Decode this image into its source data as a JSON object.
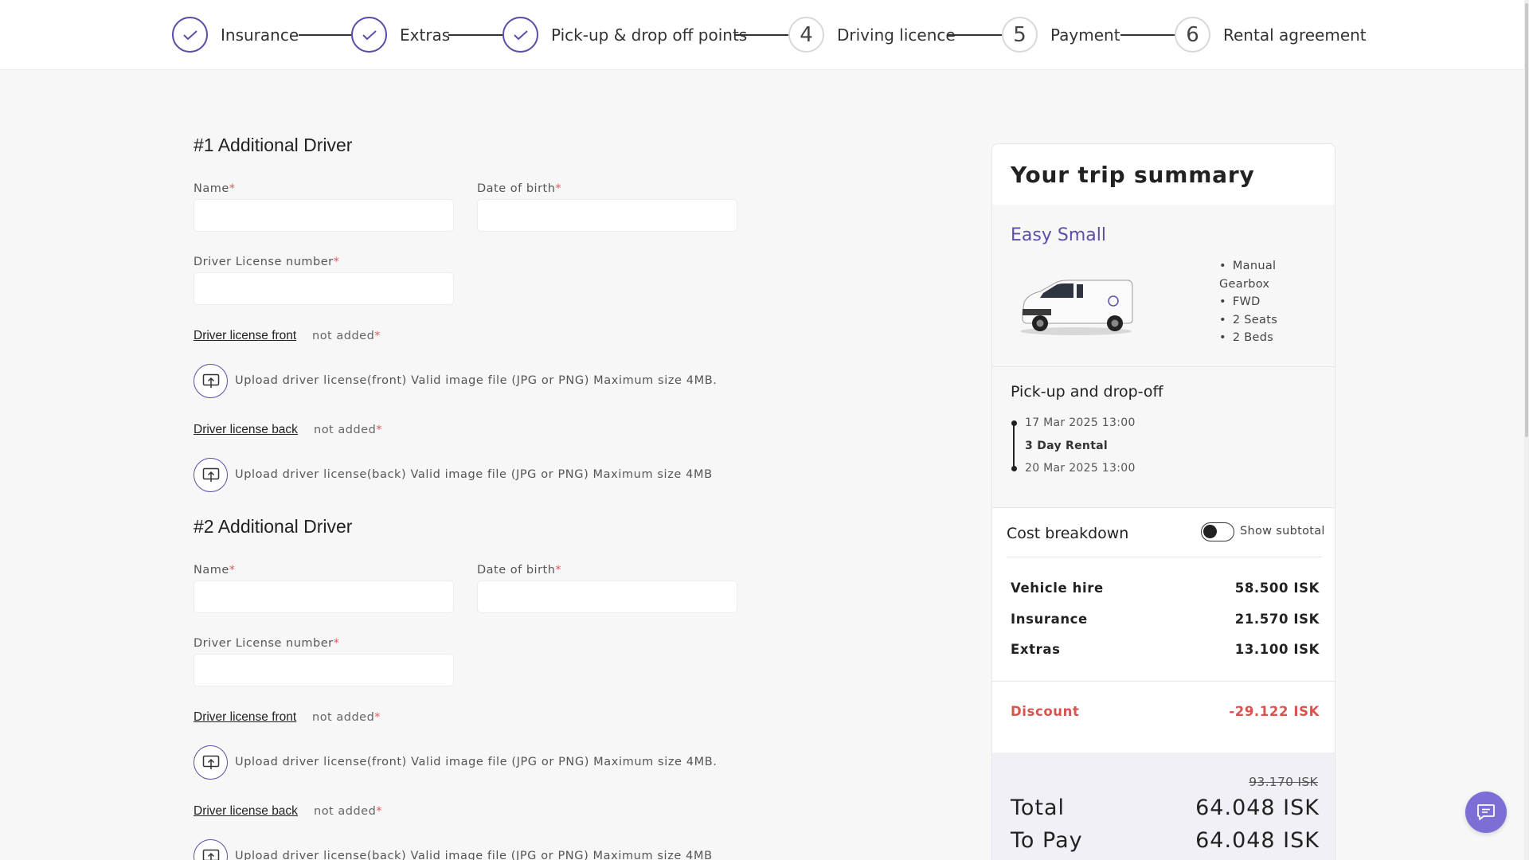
{
  "stepper": {
    "steps": [
      {
        "label": "Insurance",
        "state": "done"
      },
      {
        "label": "Extras",
        "state": "done"
      },
      {
        "label": "Pick-up & drop off points",
        "state": "done"
      },
      {
        "label": "Driving licence",
        "number": "4",
        "state": "todo"
      },
      {
        "label": "Payment",
        "number": "5",
        "state": "todo"
      },
      {
        "label": "Rental agreement",
        "number": "6",
        "state": "todo"
      }
    ]
  },
  "required_mark": "*",
  "drivers": [
    {
      "title": "#1 Additional Driver",
      "name_label": "Name",
      "dob_label": "Date of birth",
      "license_label": "Driver License number",
      "front_link": "Driver license front",
      "front_status": "not added",
      "front_upload_text": "Upload driver license(front) Valid image file (JPG or PNG) Maximum size 4MB.",
      "back_link": "Driver license back",
      "back_status": "not added",
      "back_upload_text": "Upload driver license(back) Valid image file (JPG or PNG) Maximum size 4MB"
    },
    {
      "title": "#2 Additional Driver",
      "name_label": "Name",
      "dob_label": "Date of birth",
      "license_label": "Driver License number",
      "front_link": "Driver license front",
      "front_status": "not added",
      "front_upload_text": "Upload driver license(front) Valid image file (JPG or PNG) Maximum size 4MB.",
      "back_link": "Driver license back",
      "back_status": "not added",
      "back_upload_text": "Upload driver license(back) Valid image file (JPG or PNG) Maximum size 4MB"
    }
  ],
  "summary": {
    "title": "Your trip summary",
    "vehicle_name": "Easy Small",
    "specs": [
      "Manual Gearbox",
      "FWD",
      "2 Seats",
      "2 Beds"
    ],
    "pickup_title": "Pick-up and drop-off",
    "pickup_date": "17 Mar 2025 13:00",
    "rental_length": "3 Day Rental",
    "dropoff_date": "20 Mar 2025 13:00",
    "cost_title": "Cost breakdown",
    "subtotal_toggle_label": "Show subtotal",
    "costs": [
      {
        "label": "Vehicle hire",
        "value": "58.500 ISK"
      },
      {
        "label": "Insurance",
        "value": "21.570 ISK"
      },
      {
        "label": "Extras",
        "value": "13.100 ISK"
      }
    ],
    "discount_label": "Discount",
    "discount_value": "-29.122 ISK",
    "old_total": "93.170 ISK",
    "total_label": "Total",
    "total_value": "64.048 ISK",
    "topay_label": "To Pay",
    "topay_value": "64.048 ISK"
  },
  "colors": {
    "accent": "#5b4fa6",
    "discount": "#d9534f",
    "fab": "#7b6fd6"
  }
}
